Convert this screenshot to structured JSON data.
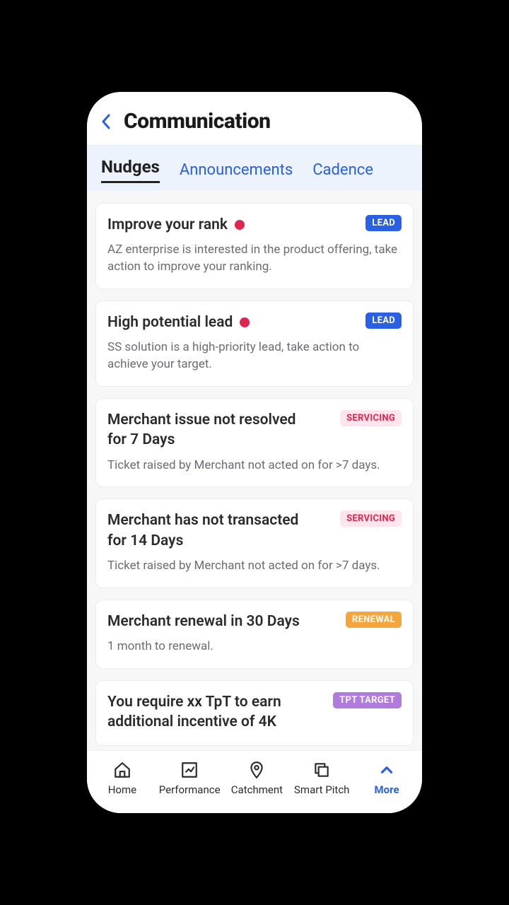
{
  "header": {
    "title": "Communication"
  },
  "tabs": [
    {
      "label": "Nudges",
      "active": true
    },
    {
      "label": "Announcements",
      "active": false
    },
    {
      "label": "Cadence",
      "active": false
    }
  ],
  "badges": {
    "lead": "LEAD",
    "servicing": "SERVICING",
    "renewal": "RENEWAL",
    "tpt": "TPT TARGET"
  },
  "nudges": [
    {
      "title": "Improve your rank",
      "dot": true,
      "badge": "lead",
      "body": "AZ enterprise is interested in the product offering, take action to improve your ranking."
    },
    {
      "title": "High potential lead",
      "dot": true,
      "badge": "lead",
      "body": "SS solution is a high-priority lead, take action to achieve your target."
    },
    {
      "title": "Merchant issue not resolved for 7 Days",
      "dot": false,
      "badge": "servicing",
      "body": "Ticket raised by Merchant not acted on for >7 days."
    },
    {
      "title": "Merchant has not transacted for 14 Days",
      "dot": false,
      "badge": "servicing",
      "body": "Ticket raised by Merchant not acted on for >7 days."
    },
    {
      "title": "Merchant renewal in 30 Days",
      "dot": false,
      "badge": "renewal",
      "body": "1 month to renewal."
    },
    {
      "title": "You require xx TpT to earn additional incentive of 4K",
      "dot": false,
      "badge": "tpt",
      "body": ""
    }
  ],
  "bottom_nav": [
    {
      "label": "Home",
      "icon": "home-icon",
      "active": false
    },
    {
      "label": "Performance",
      "icon": "chart-icon",
      "active": false
    },
    {
      "label": "Catchment",
      "icon": "map-pin-icon",
      "active": false
    },
    {
      "label": "Smart Pitch",
      "icon": "copy-icon",
      "active": false
    },
    {
      "label": "More",
      "icon": "chevron-up-icon",
      "active": true
    }
  ],
  "colors": {
    "primary": "#2a60e4",
    "danger": "#e0264f",
    "warning": "#f5a53a",
    "purple": "#b07bdc"
  }
}
